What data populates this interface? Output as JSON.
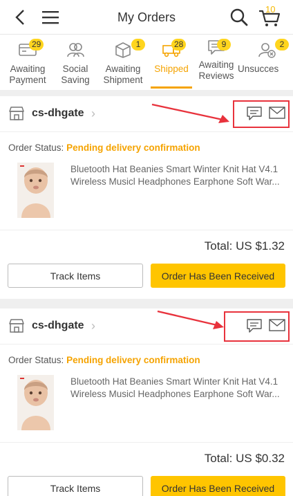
{
  "header": {
    "title": "My Orders",
    "cart_count": "10"
  },
  "tabs": [
    {
      "label": "Awaiting\nPayment",
      "badge": "29",
      "icon": "payment-icon"
    },
    {
      "label": "Social\nSaving",
      "badge": "",
      "icon": "group-icon"
    },
    {
      "label": "Awaiting\nShipment",
      "badge": "1",
      "icon": "box-icon"
    },
    {
      "label": "Shipped",
      "badge": "28",
      "icon": "truck-icon",
      "active": true
    },
    {
      "label": "Awaiting\nReviews",
      "badge": "9",
      "icon": "review-icon"
    },
    {
      "label": "Unsucces",
      "badge": "2",
      "icon": "unsuccessful-icon"
    }
  ],
  "orders": [
    {
      "store": "cs-dhgate",
      "status_label": "Order Status:",
      "status_value": "Pending delivery confirmation",
      "product_line1": "Bluetooth Hat Beanies Smart Winter Knit Hat V4.1",
      "product_line2": "Wireless Musicl Headphones Earphone Soft War...",
      "total": "Total: US $1.32",
      "track_label": "Track Items",
      "received_label": "Order Has Been Received"
    },
    {
      "store": "cs-dhgate",
      "status_label": "Order Status:",
      "status_value": "Pending delivery confirmation",
      "product_line1": "Bluetooth Hat Beanies Smart Winter Knit Hat V4.1",
      "product_line2": "Wireless Musicl Headphones Earphone Soft War...",
      "total": "Total: US $0.32",
      "track_label": "Track Items",
      "received_label": "Order Has Been Received"
    }
  ],
  "colors": {
    "accent": "#f5a300",
    "button_primary": "#ffc500",
    "badge": "#ffd51e",
    "highlight_box": "#e8323c"
  }
}
